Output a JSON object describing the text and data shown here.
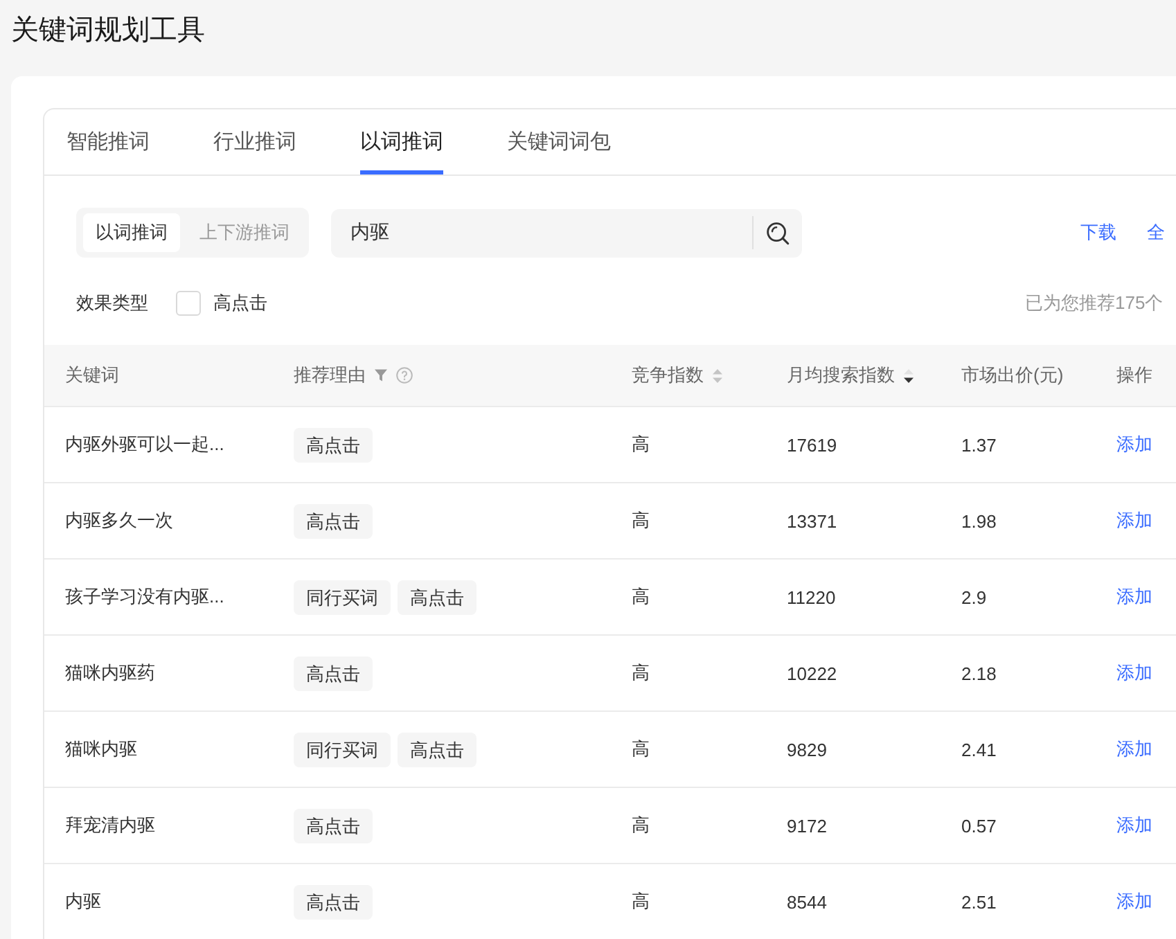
{
  "page": {
    "title": "关键词规划工具"
  },
  "tabs": [
    {
      "label": "智能推词",
      "selected": false
    },
    {
      "label": "行业推词",
      "selected": false
    },
    {
      "label": "以词推词",
      "selected": true
    },
    {
      "label": "关键词词包",
      "selected": false
    }
  ],
  "mode_switch": [
    {
      "label": "以词推词",
      "selected": true
    },
    {
      "label": "上下游推词",
      "selected": false
    }
  ],
  "search": {
    "value": "内驱"
  },
  "actions": [
    "下载",
    "全"
  ],
  "filter": {
    "label": "效果类型",
    "options": [
      {
        "label": "高点击",
        "checked": false
      }
    ]
  },
  "result_count": "已为您推荐175个",
  "table": {
    "columns": [
      {
        "label": "关键词",
        "kind": "plain"
      },
      {
        "label": "推荐理由",
        "kind": "filterable"
      },
      {
        "label": "竞争指数",
        "kind": "sortable"
      },
      {
        "label": "月均搜索指数",
        "kind": "sorted"
      },
      {
        "label": "市场出价(元)",
        "kind": "plain"
      },
      {
        "label": "操作",
        "kind": "plain"
      }
    ],
    "rows": [
      {
        "keyword": "内驱外驱可以一起...",
        "reasons": [
          "高点击"
        ],
        "competition": "高",
        "search_index": "17619",
        "price": "1.37",
        "action": "添加"
      },
      {
        "keyword": "内驱多久一次",
        "reasons": [
          "高点击"
        ],
        "competition": "高",
        "search_index": "13371",
        "price": "1.98",
        "action": "添加"
      },
      {
        "keyword": "孩子学习没有内驱...",
        "reasons": [
          "同行买词",
          "高点击"
        ],
        "competition": "高",
        "search_index": "11220",
        "price": "2.9",
        "action": "添加"
      },
      {
        "keyword": "猫咪内驱药",
        "reasons": [
          "高点击"
        ],
        "competition": "高",
        "search_index": "10222",
        "price": "2.18",
        "action": "添加"
      },
      {
        "keyword": "猫咪内驱",
        "reasons": [
          "同行买词",
          "高点击"
        ],
        "competition": "高",
        "search_index": "9829",
        "price": "2.41",
        "action": "添加"
      },
      {
        "keyword": "拜宠清内驱",
        "reasons": [
          "高点击"
        ],
        "competition": "高",
        "search_index": "9172",
        "price": "0.57",
        "action": "添加"
      },
      {
        "keyword": "内驱",
        "reasons": [
          "高点击"
        ],
        "competition": "高",
        "search_index": "8544",
        "price": "2.51",
        "action": "添加"
      }
    ]
  }
}
